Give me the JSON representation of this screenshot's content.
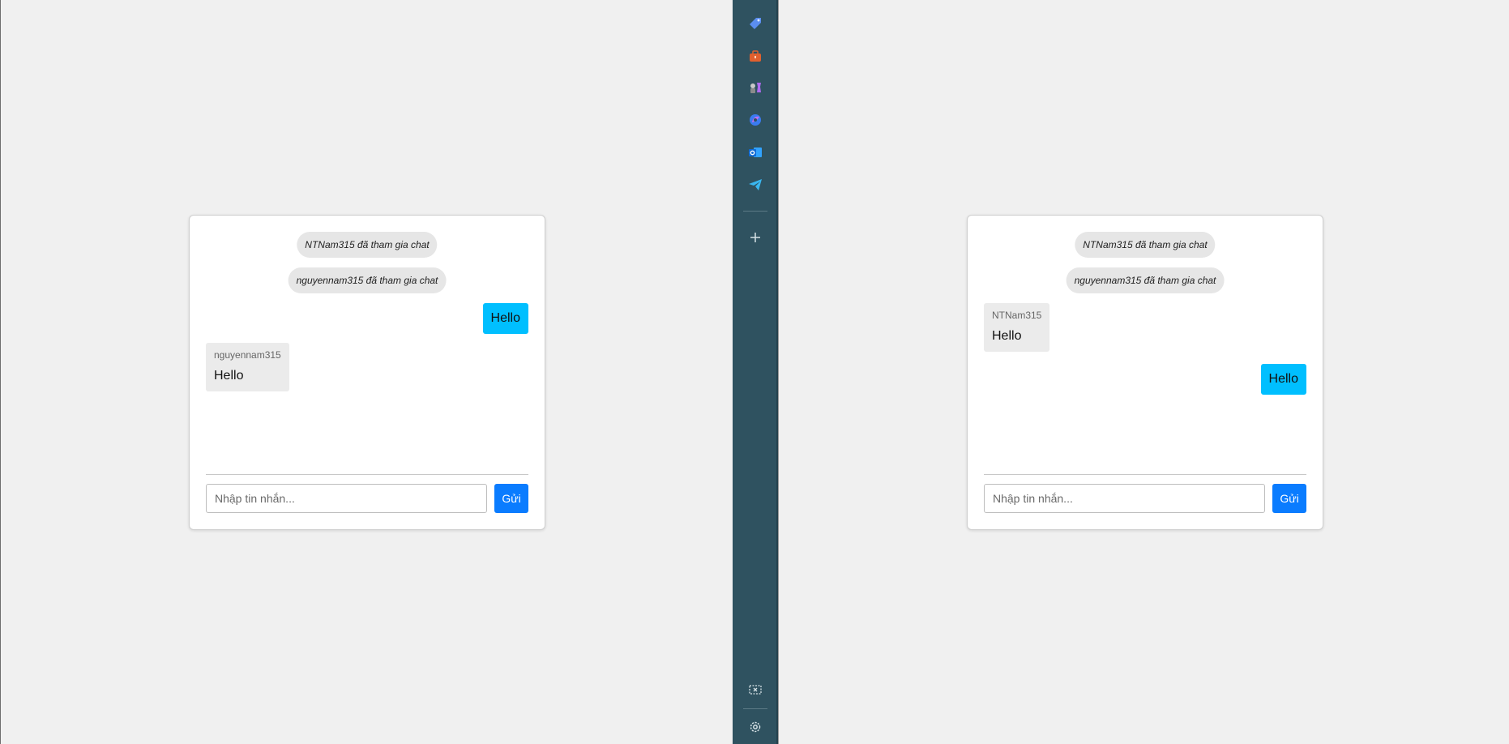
{
  "left_chat": {
    "system_messages": [
      "NTNam315 đã tham gia chat",
      "nguyennam315 đã tham gia chat"
    ],
    "mine": {
      "text": "Hello"
    },
    "other": {
      "sender": "nguyennam315",
      "text": "Hello"
    },
    "input_placeholder": "Nhập tin nhắn...",
    "send_label": "Gửi"
  },
  "right_chat": {
    "system_messages": [
      "NTNam315 đã tham gia chat",
      "nguyennam315 đã tham gia chat"
    ],
    "other": {
      "sender": "NTNam315",
      "text": "Hello"
    },
    "mine": {
      "text": "Hello"
    },
    "input_placeholder": "Nhập tin nhắn...",
    "send_label": "Gửi"
  },
  "sidebar": {
    "items": [
      {
        "icon": "tag-icon"
      },
      {
        "icon": "toolbox-icon"
      },
      {
        "icon": "games-icon"
      },
      {
        "icon": "copilot-icon"
      },
      {
        "icon": "outlook-icon"
      },
      {
        "icon": "telegram-icon"
      }
    ],
    "add_icon": "plus-icon",
    "bottom": [
      {
        "icon": "screenshot-icon"
      },
      {
        "icon": "settings-icon"
      }
    ]
  },
  "colors": {
    "sidebar_bg": "#2f5260",
    "my_bubble": "#00bfff",
    "send_button": "#0a7cff",
    "page_bg": "#f0f0f0"
  }
}
